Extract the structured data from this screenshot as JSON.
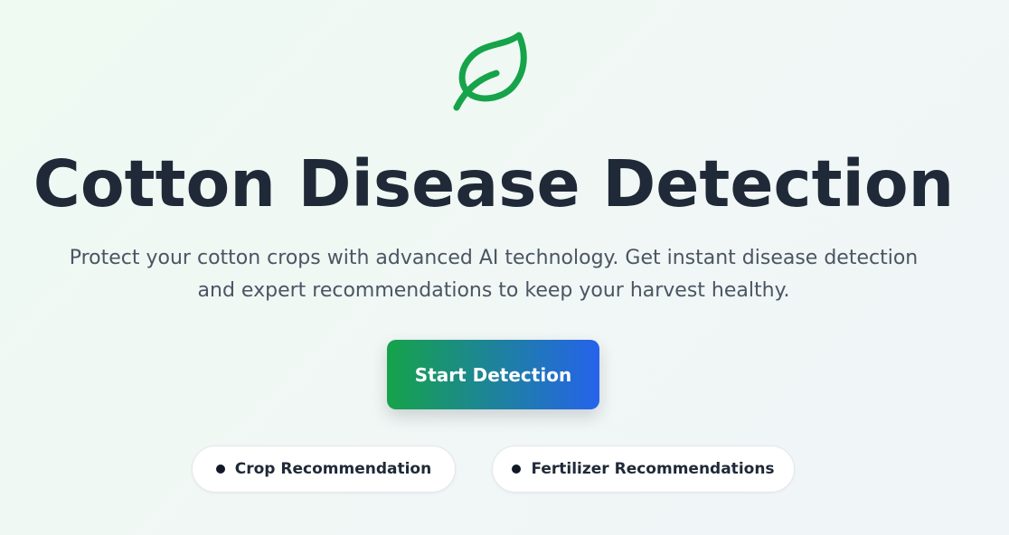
{
  "hero": {
    "icon": "leaf-icon",
    "title": "Cotton Disease Detection",
    "subtitle": "Protect your cotton crops with advanced AI technology. Get instant disease detection and expert recommendations to keep your harvest healthy.",
    "cta_label": "Start Detection",
    "links": [
      {
        "label": "Crop Recommendation",
        "icon": "bullet-icon"
      },
      {
        "label": "Fertilizer Recommendations",
        "icon": "bullet-icon"
      }
    ]
  },
  "colors": {
    "accent_green": "#16a34a",
    "accent_blue": "#2563eb",
    "title": "#1f2937",
    "subtitle": "#4b5563"
  }
}
